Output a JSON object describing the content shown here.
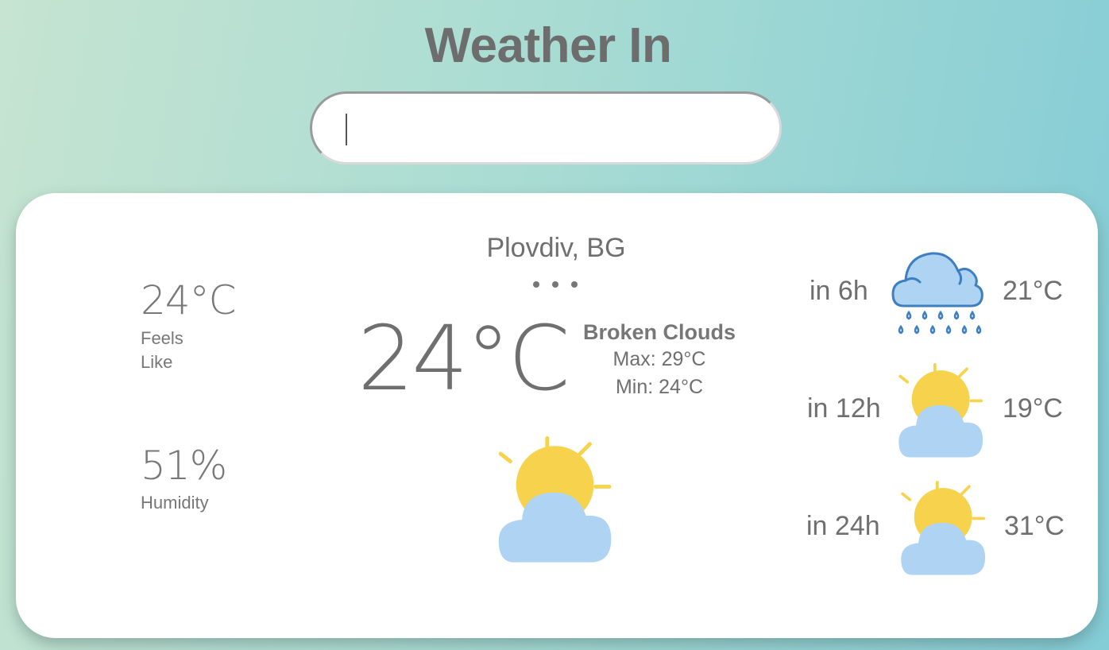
{
  "header": {
    "title": "Weather In"
  },
  "search": {
    "value": "",
    "placeholder": ""
  },
  "current": {
    "location": "Plovdiv, BG",
    "temperature": "24°C",
    "condition": "Broken Clouds",
    "max": "Max: 29°C",
    "min": "Min: 24°C",
    "icon": "sun-behind-cloud-icon"
  },
  "stats": {
    "feels_like_value": "24°C",
    "feels_like_label_line1": "Feels",
    "feels_like_label_line2": "Like",
    "humidity_value": "51%",
    "humidity_label": "Humidity"
  },
  "forecast": [
    {
      "time": "in 6h",
      "temp": "21°C",
      "icon": "rain-cloud-icon"
    },
    {
      "time": "in 12h",
      "temp": "19°C",
      "icon": "sun-behind-cloud-icon"
    },
    {
      "time": "in 24h",
      "temp": "31°C",
      "icon": "sun-behind-cloud-icon"
    }
  ],
  "colors": {
    "sun": "#f7d24d",
    "cloud": "#aed3f3",
    "rain_cloud_stroke": "#3d7fc1",
    "rain_drop": "#3d7fc1"
  }
}
